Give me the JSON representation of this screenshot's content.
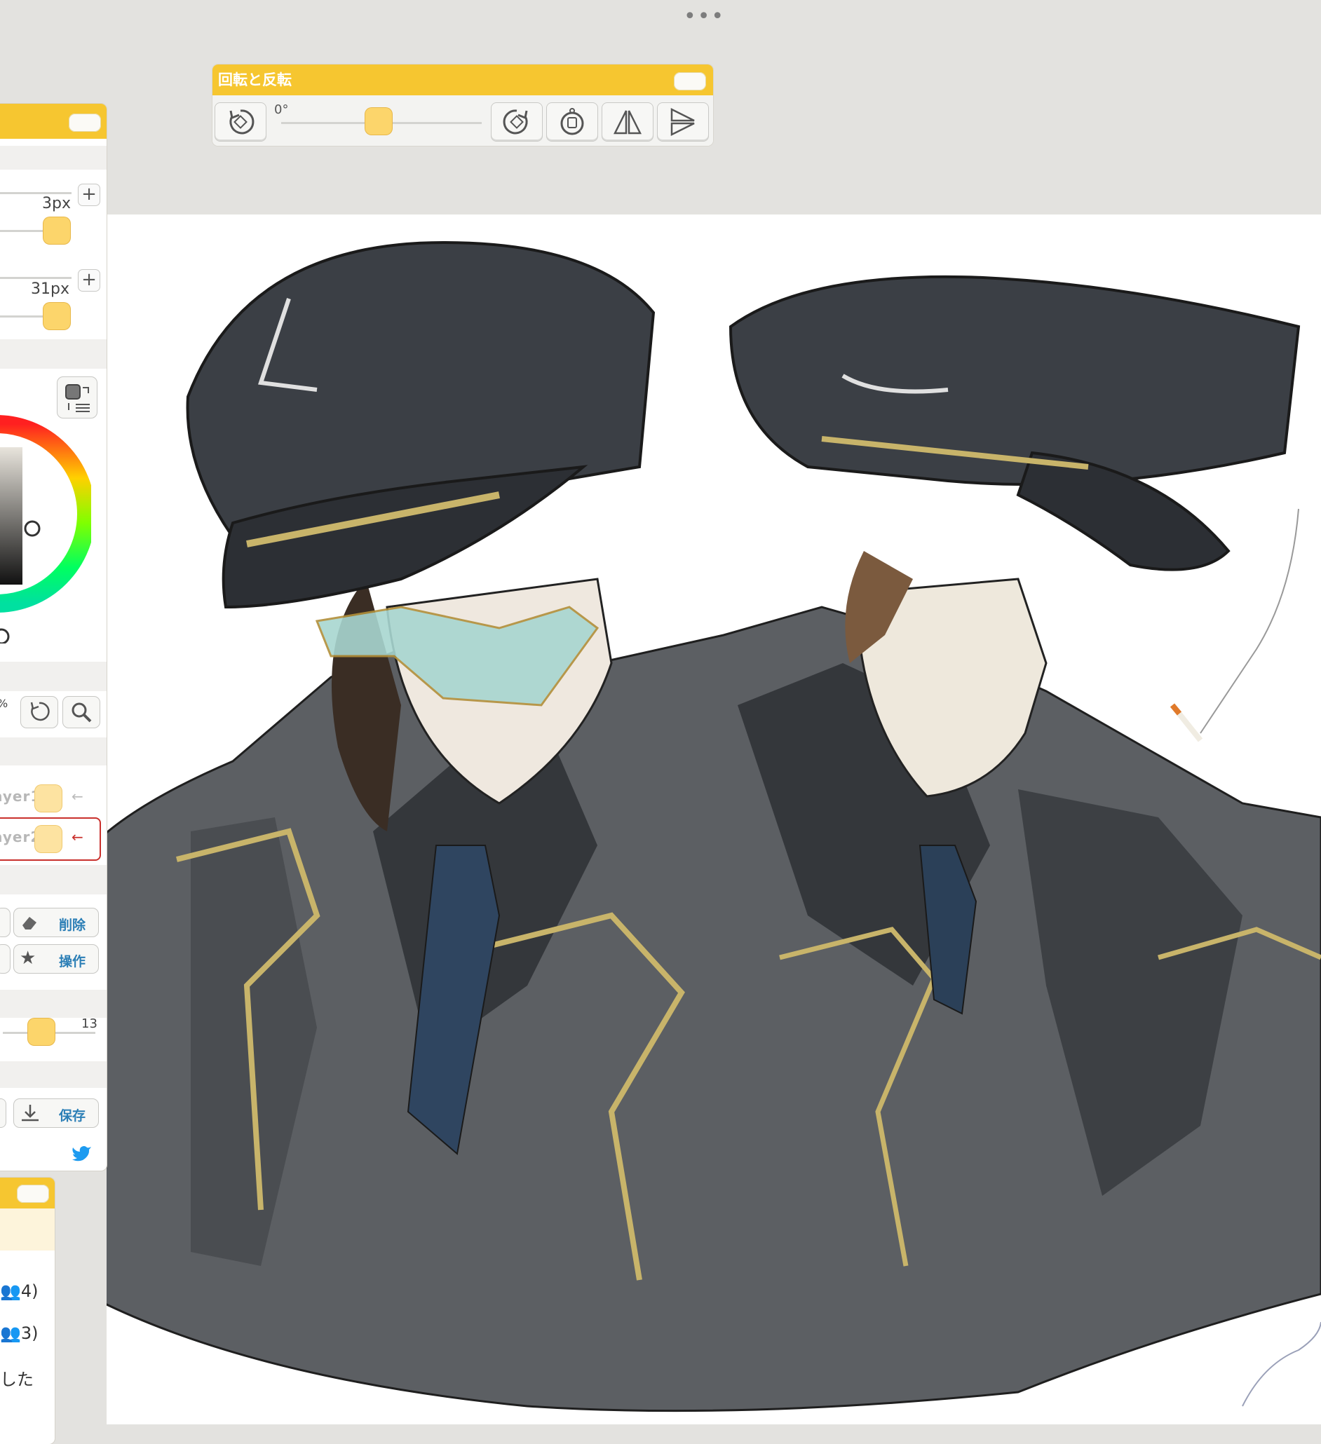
{
  "rotate_panel": {
    "title": "回転と反転",
    "angle_label": "0°",
    "angle_value": 0,
    "buttons": [
      "rotate-left",
      "rotate-right",
      "reset-rotation",
      "flip-horizontal",
      "flip-vertical"
    ]
  },
  "brush": {
    "size_label": "3px",
    "size2_label": "31px"
  },
  "layers": [
    {
      "label": "ayer1",
      "index": "1"
    },
    {
      "label": "ayer2",
      "index": "2"
    }
  ],
  "actions": {
    "delete_label": "削除",
    "operate_label": "操作",
    "save_label": "保存"
  },
  "opacity_slider": {
    "value_label": "13"
  },
  "zoom_fragment": "%",
  "chat": {
    "line1": "👥4)",
    "line2": "👥3)",
    "line3": "した"
  },
  "colors": {
    "accent": "#f6c630",
    "knob": "#fcd56b",
    "link": "#2c7fb6",
    "active_layer_border": "#c9302c"
  },
  "icons": [
    "more-dots-icon",
    "rotate-left-icon",
    "rotate-right-icon",
    "reset-rotation-icon",
    "flip-horizontal-icon",
    "flip-vertical-icon",
    "plus-icon",
    "color-swap-icon",
    "undo-icon",
    "zoom-icon",
    "eraser-icon",
    "star-icon",
    "download-icon",
    "twitter-icon",
    "arrow-left-icon"
  ]
}
